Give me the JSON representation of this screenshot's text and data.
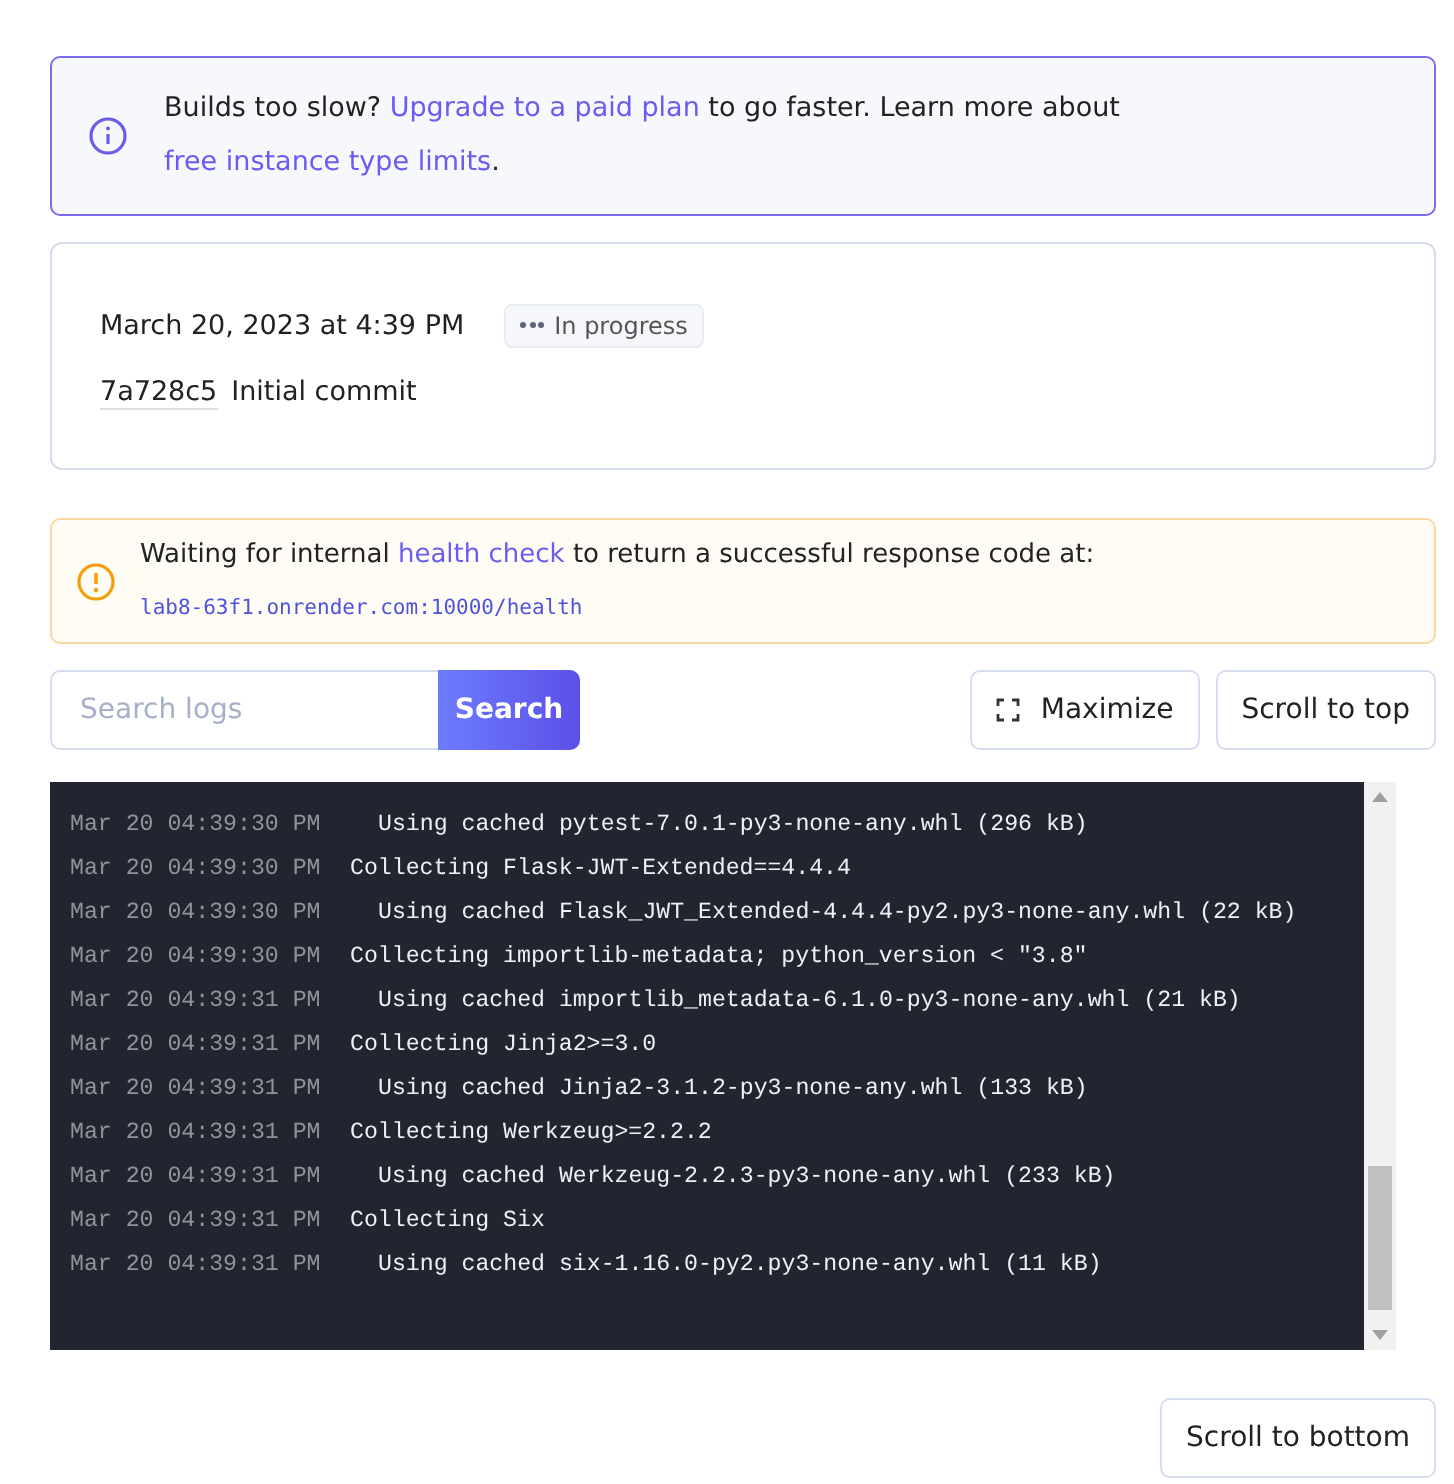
{
  "info_banner": {
    "parts": [
      {
        "kind": "text",
        "text": "Builds too slow? "
      },
      {
        "kind": "link",
        "text": "Upgrade to a paid plan"
      },
      {
        "kind": "text",
        "text": " to go faster. Learn more about "
      },
      {
        "kind": "link",
        "text": "free instance type limits"
      },
      {
        "kind": "text",
        "text": "."
      }
    ]
  },
  "deploy": {
    "date": "March 20, 2023 at 4:39 PM",
    "status": "In progress",
    "commit_hash": "7a728c5",
    "commit_message": "Initial commit"
  },
  "warning_banner": {
    "parts": [
      {
        "kind": "text",
        "text": "Waiting for internal "
      },
      {
        "kind": "link",
        "text": "health check"
      },
      {
        "kind": "text",
        "text": " to return a successful response code at: "
      },
      {
        "kind": "code",
        "text": "lab8-63f1.onrender.com:10000/health"
      }
    ]
  },
  "search": {
    "placeholder": "Search logs",
    "button": "Search"
  },
  "toolbar_buttons": [
    "Maximize",
    "Scroll to top"
  ],
  "log_lines": [
    {
      "time": "Mar 20 04:39:30 PM",
      "kind": "detail",
      "message": "Using cached pytest-7.0.1-py3-none-any.whl (296 kB)"
    },
    {
      "time": "Mar 20 04:39:30 PM",
      "kind": "step",
      "message": "Collecting Flask-JWT-Extended==4.4.4"
    },
    {
      "time": "Mar 20 04:39:30 PM",
      "kind": "detail",
      "message": "Using cached Flask_JWT_Extended-4.4.4-py2.py3-none-any.whl (22 kB)"
    },
    {
      "time": "Mar 20 04:39:30 PM",
      "kind": "step",
      "message": "Collecting importlib-metadata; python_version < \"3.8\""
    },
    {
      "time": "Mar 20 04:39:31 PM",
      "kind": "detail",
      "message": "Using cached importlib_metadata-6.1.0-py3-none-any.whl (21 kB)"
    },
    {
      "time": "Mar 20 04:39:31 PM",
      "kind": "step",
      "message": "Collecting Jinja2>=3.0"
    },
    {
      "time": "Mar 20 04:39:31 PM",
      "kind": "detail",
      "message": "Using cached Jinja2-3.1.2-py3-none-any.whl (133 kB)"
    },
    {
      "time": "Mar 20 04:39:31 PM",
      "kind": "step",
      "message": "Collecting Werkzeug>=2.2.2"
    },
    {
      "time": "Mar 20 04:39:31 PM",
      "kind": "detail",
      "message": "Using cached Werkzeug-2.2.3-py3-none-any.whl (233 kB)"
    },
    {
      "time": "Mar 20 04:39:31 PM",
      "kind": "step",
      "message": "Collecting Six"
    },
    {
      "time": "Mar 20 04:39:31 PM",
      "kind": "detail",
      "message": "Using cached six-1.16.0-py2.py3-none-any.whl (11 kB)"
    }
  ],
  "footer_button": "Scroll to bottom"
}
